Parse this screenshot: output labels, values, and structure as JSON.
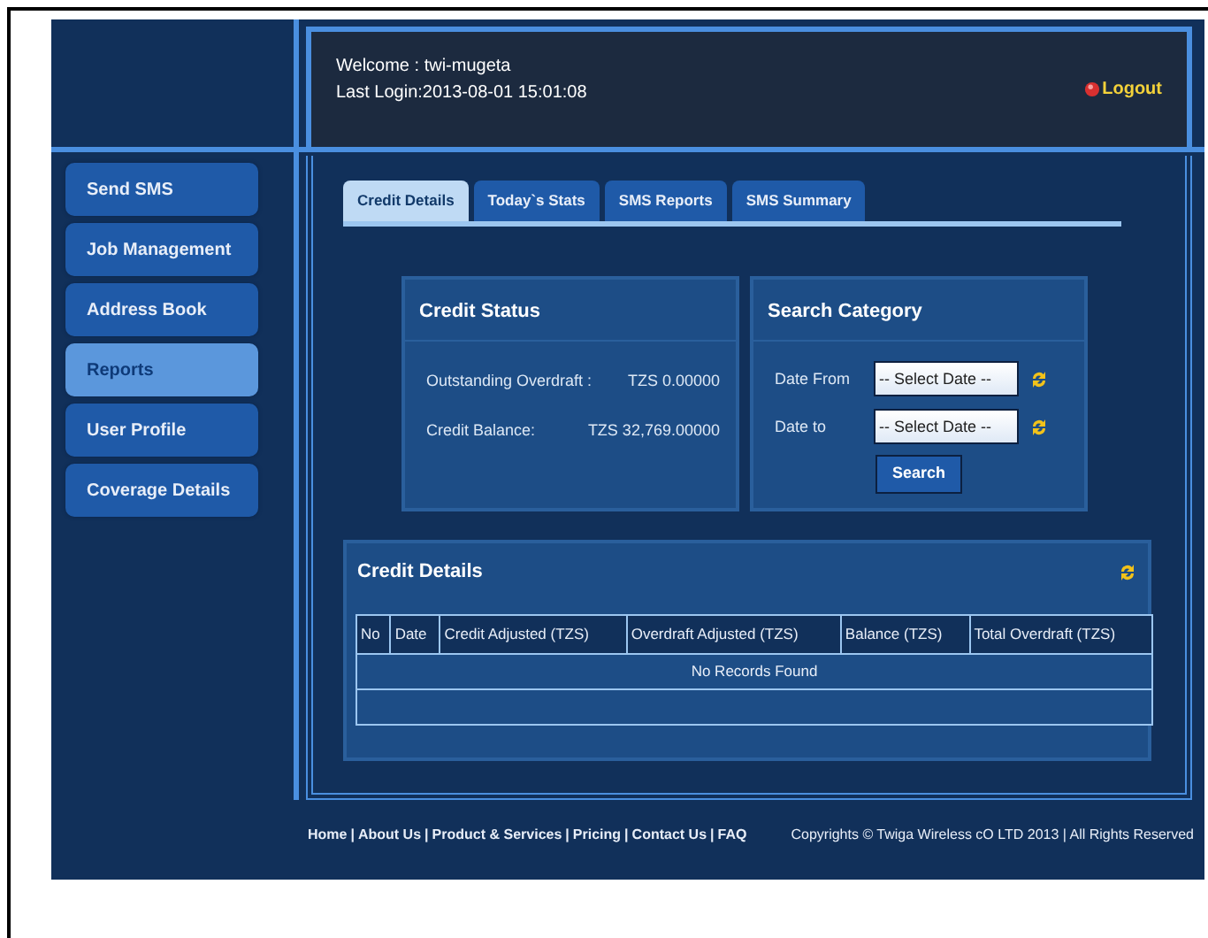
{
  "header": {
    "welcome": "Welcome : twi-mugeta",
    "last_login": "Last Login:2013-08-01 15:01:08",
    "logout": "Logout"
  },
  "sidebar": {
    "items": [
      {
        "label": "Send SMS",
        "selected": false
      },
      {
        "label": "Job Management",
        "selected": false
      },
      {
        "label": "Address Book",
        "selected": false
      },
      {
        "label": "Reports",
        "selected": true
      },
      {
        "label": "User Profile",
        "selected": false
      },
      {
        "label": "Coverage Details",
        "selected": false
      }
    ]
  },
  "tabs": [
    {
      "label": "Credit Details",
      "selected": true
    },
    {
      "label": "Today`s Stats",
      "selected": false
    },
    {
      "label": "SMS Reports",
      "selected": false
    },
    {
      "label": "SMS Summary",
      "selected": false
    }
  ],
  "credit_status": {
    "title": "Credit Status",
    "rows": [
      {
        "label": "Outstanding Overdraft :",
        "value": "TZS 0.00000"
      },
      {
        "label": "Credit Balance:",
        "value": "TZS 32,769.00000"
      }
    ]
  },
  "search_category": {
    "title": "Search Category",
    "fields": [
      {
        "label": "Date From",
        "value": "-- Select Date --"
      },
      {
        "label": "Date to",
        "value": "-- Select Date --"
      }
    ],
    "button": "Search"
  },
  "credit_details": {
    "title": "Credit Details",
    "table": {
      "columns": [
        "No",
        "Date",
        "Credit Adjusted (TZS)",
        "Overdraft Adjusted (TZS)",
        "Balance (TZS)",
        "Total Overdraft (TZS)"
      ],
      "empty_message": "No Records Found"
    }
  },
  "footer": {
    "links": [
      "Home",
      "About Us",
      "Product & Services",
      "Pricing",
      "Contact Us",
      "FAQ"
    ],
    "separator": "|",
    "copyright": "Copyrights © Twiga Wireless cO LTD 2013 | All Rights Reserved"
  }
}
